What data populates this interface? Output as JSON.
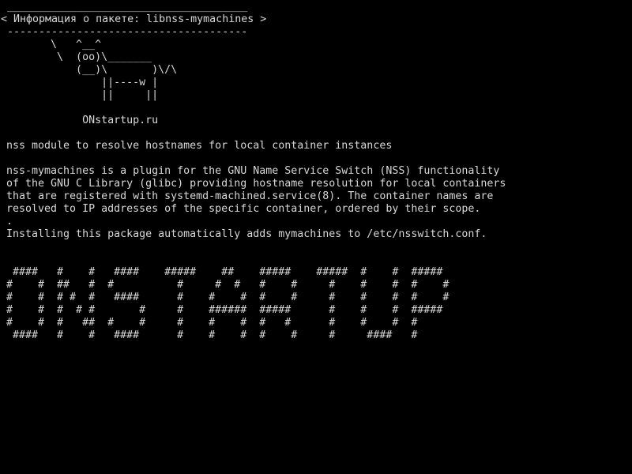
{
  "screen": {
    "background_color": "#000000",
    "text_color": "#d8d8d8"
  },
  "cowsay": {
    "border_top": " ______________________________________",
    "title": "< Информация о пакете: libnss-mymachines >",
    "border_bottom": " --------------------------------------",
    "cow": [
      "       \\   ^__^",
      "        \\  (oo)\\_______",
      "           (__)\\       )\\/\\",
      "               ||----w |",
      "               ||     ||"
    ],
    "site": "            ONstartup.ru"
  },
  "package": {
    "short_description": "nss module to resolve hostnames for local container instances",
    "long_description": [
      "nss-mymachines is a plugin for the GNU Name Service Switch (NSS) functionality",
      "of the GNU C Library (glibc) providing hostname resolution for local containers",
      "that are registered with systemd-machined.service(8). The container names are",
      "resolved to IP addresses of the specific container, ordered by their scope.",
      ".",
      "Installing this package automatically adds mymachines to /etc/nsswitch.conf."
    ]
  },
  "banner": {
    "lines": [
      " ####   #    #   ####    #####    ##    #####    #####  #    #  #####",
      "#    #  ##   #  #          #     #  #   #    #     #    #    #  #    #",
      "#    #  # #  #   ####      #    #    #  #    #     #    #    #  #    #",
      "#    #  #  # #       #     #    ######  #####      #    #    #  #####",
      "#    #  #   ##  #    #     #    #    #  #   #      #    #    #  #",
      " ####   #    #   ####      #    #    #  #    #     #     ####   #"
    ]
  }
}
